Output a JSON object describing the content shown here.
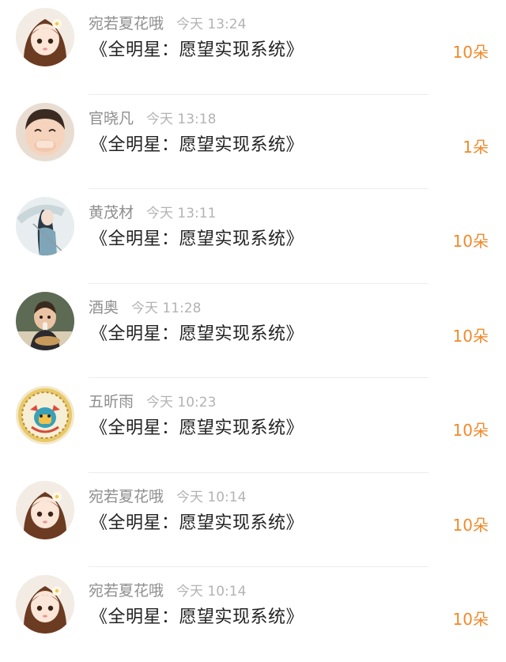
{
  "colors": {
    "name": "#8e8e8e",
    "time": "#b3b3b3",
    "title": "#222222",
    "amount": "#f08a2c",
    "divider": "#ececec"
  },
  "records": [
    {
      "user": "宛若夏花哦",
      "time": "今天 13:24",
      "book": "《全明星：愿望实现系统》",
      "amount": "10朵",
      "avatar": "doll-girl-avatar"
    },
    {
      "user": "官晓凡",
      "time": "今天 13:18",
      "book": "《全明星：愿望实现系统》",
      "amount": "1朵",
      "avatar": "laughing-boy-avatar"
    },
    {
      "user": "黄茂材",
      "time": "今天 13:11",
      "book": "《全明星：愿望实现系统》",
      "amount": "10朵",
      "avatar": "umbrella-girl-avatar"
    },
    {
      "user": "酒奥",
      "time": "今天 11:28",
      "book": "《全明星：愿望实现系统》",
      "amount": "10朵",
      "avatar": "toddler-avatar"
    },
    {
      "user": "五昕雨",
      "time": "今天 10:23",
      "book": "《全明星：愿望实现系统》",
      "amount": "10朵",
      "avatar": "ox-badge-avatar"
    },
    {
      "user": "宛若夏花哦",
      "time": "今天 10:14",
      "book": "《全明星：愿望实现系统》",
      "amount": "10朵",
      "avatar": "doll-girl-avatar"
    },
    {
      "user": "宛若夏花哦",
      "time": "今天 10:14",
      "book": "《全明星：愿望实现系统》",
      "amount": "10朵",
      "avatar": "doll-girl-avatar"
    }
  ]
}
